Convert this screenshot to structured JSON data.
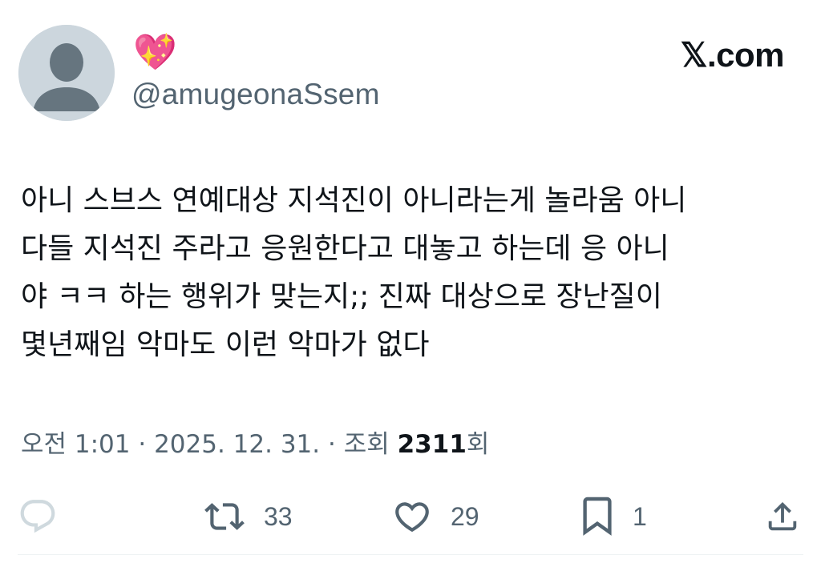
{
  "header": {
    "display_name": "💖",
    "handle": "@amugeonaSsem",
    "brand": "𝕏.com"
  },
  "tweet": {
    "lines": [
      "아니 스브스 연예대상 지석진이 아니라는게 놀라움 아니",
      "다들 지석진 주라고 응원한다고 대놓고 하는데 응 아니",
      "야 ㅋㅋ 하는 행위가 맞는지;; 진짜 대상으로 장난질이",
      "몇년째임 악마도 이런 악마가 없다"
    ]
  },
  "meta": {
    "time": "오전 1:01",
    "separator": " · ",
    "date": "2025. 12. 31.",
    "views_label": "조회 ",
    "views_count": "2311",
    "views_suffix": "회"
  },
  "actions": {
    "reply": {
      "icon": "reply-icon",
      "count": ""
    },
    "retweet": {
      "icon": "retweet-icon",
      "count": "33"
    },
    "like": {
      "icon": "heart-icon",
      "count": "29"
    },
    "bookmark": {
      "icon": "bookmark-icon",
      "count": "1"
    },
    "share": {
      "icon": "share-icon",
      "count": ""
    }
  },
  "colors": {
    "text": "#0f1419",
    "secondary": "#536471",
    "reply_icon": "#cfd9de",
    "avatar_bg": "#ccd6dd",
    "avatar_fg": "#66757f",
    "divider": "#eff3f4"
  }
}
